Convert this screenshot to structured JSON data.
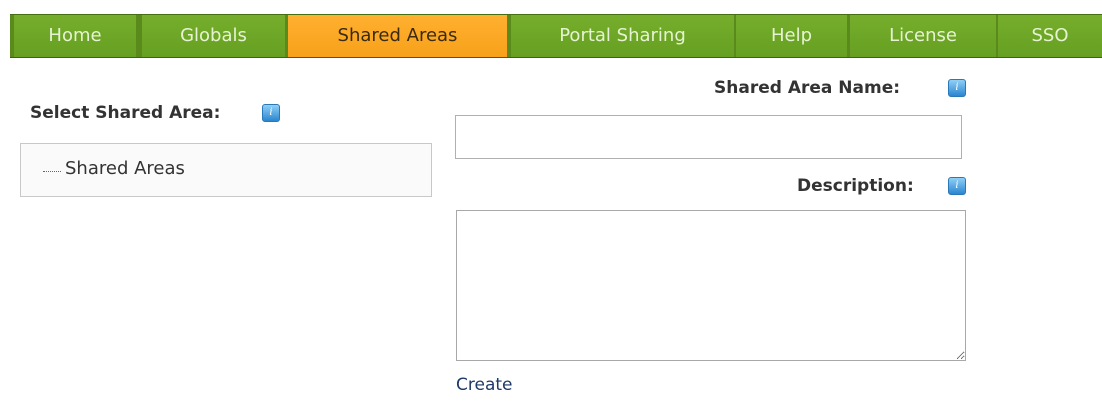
{
  "nav": {
    "tabs": [
      {
        "label": "Home",
        "active": false
      },
      {
        "label": "Globals",
        "active": false
      },
      {
        "label": "Shared Areas",
        "active": true
      },
      {
        "label": "Portal Sharing",
        "active": false
      },
      {
        "label": "Help",
        "active": false
      },
      {
        "label": "License",
        "active": false
      },
      {
        "label": "SSO",
        "active": false
      }
    ],
    "colors": {
      "tab": "#6fa827",
      "active_tab": "#ffa722",
      "bar": "#5a8a1c"
    }
  },
  "left": {
    "select_label": "Select Shared Area:",
    "tree": {
      "root_label": "Shared Areas"
    }
  },
  "form": {
    "name_label": "Shared Area Name:",
    "name_value": "",
    "description_label": "Description:",
    "description_value": "",
    "create_label": "Create"
  },
  "icons": {
    "help": "help-info-icon"
  }
}
